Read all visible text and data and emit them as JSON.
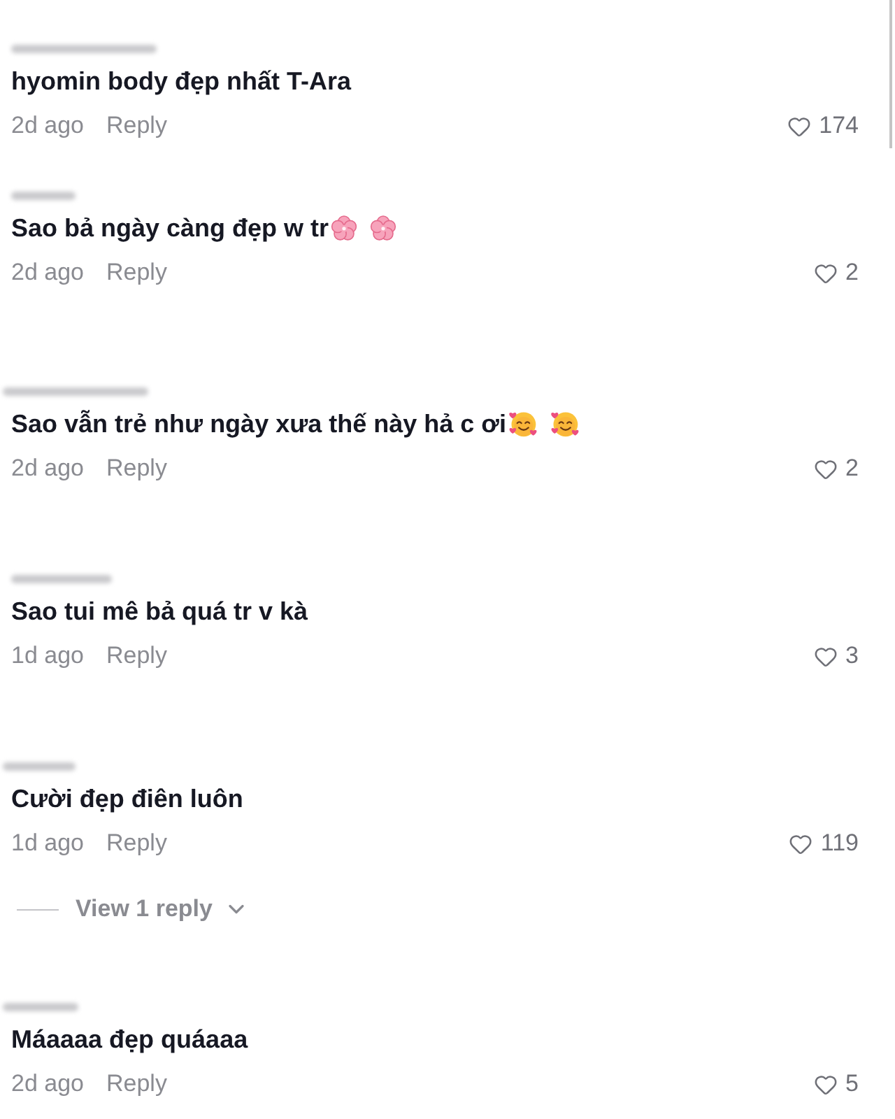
{
  "comments": [
    {
      "text": "hyomin body đẹp nhất T-Ara",
      "time": "2d ago",
      "reply": "Reply",
      "liked": false,
      "likes": "174"
    },
    {
      "text": "Sao bả ngày càng đẹp w tr",
      "emojis": [
        {
          "kind": "blossom"
        },
        {
          "kind": "blossom"
        }
      ],
      "time": "2d ago",
      "reply": "Reply",
      "liked": false,
      "likes": "2"
    },
    {
      "text": "Sao vẫn trẻ như ngày xưa thế này hả c ơi",
      "emojis": [
        {
          "kind": "hearts-face"
        },
        {
          "kind": "hearts-face"
        }
      ],
      "time": "2d ago",
      "reply": "Reply",
      "liked": false,
      "likes": "2"
    },
    {
      "text": "Sao tui mê bả quá tr v kà",
      "time": "1d ago",
      "reply": "Reply",
      "liked": false,
      "likes": "3"
    },
    {
      "text": "Cười đẹp điên luôn",
      "time": "1d ago",
      "reply": "Reply",
      "liked": false,
      "likes": "119",
      "replies": {
        "label": "View 1 reply",
        "expanded": false
      }
    },
    {
      "text": "Máaaaa đẹp quáaaa",
      "time": "2d ago",
      "reply": "Reply",
      "liked": false,
      "likes": "5"
    }
  ]
}
